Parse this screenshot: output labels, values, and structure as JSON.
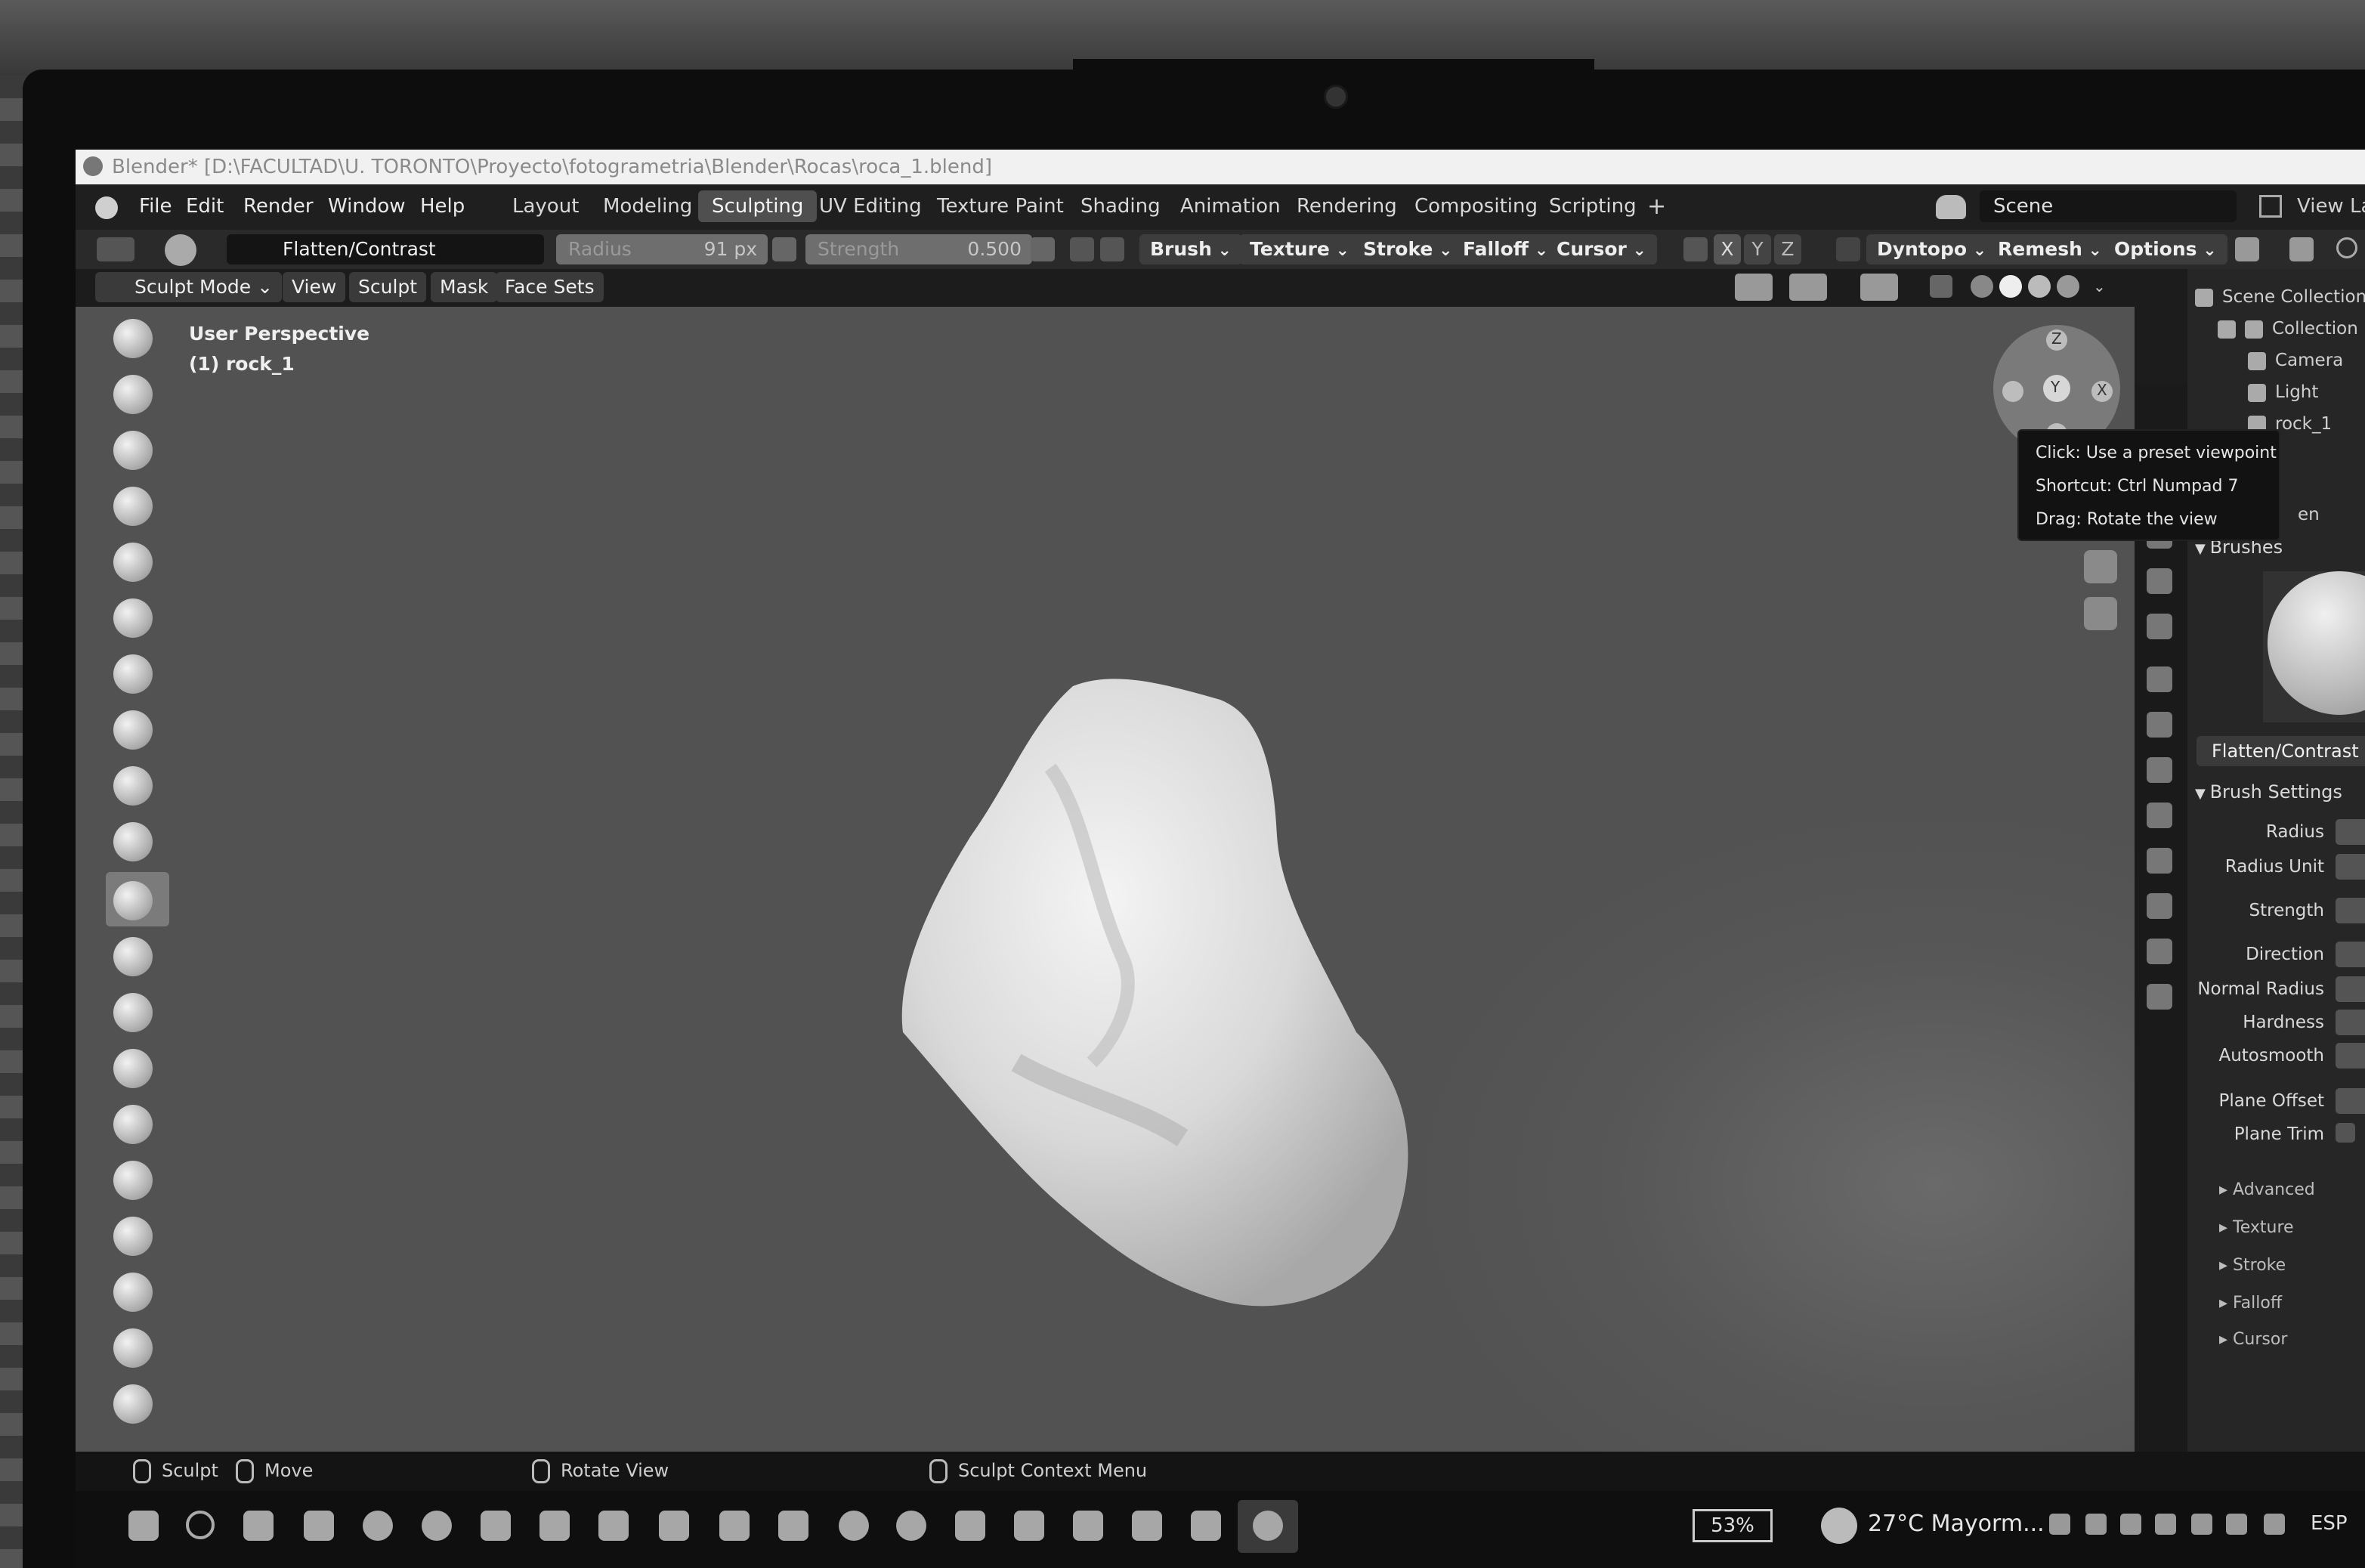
{
  "window": {
    "title": "Blender* [D:\\FACULTAD\\U. TORONTO\\Proyecto\\fotogrametria\\Blender\\Rocas\\roca_1.blend]"
  },
  "menu": {
    "items": [
      "File",
      "Edit",
      "Render",
      "Window",
      "Help"
    ]
  },
  "workspaces": {
    "tabs": [
      "Layout",
      "Modeling",
      "Sculpting",
      "UV Editing",
      "Texture Paint",
      "Shading",
      "Animation",
      "Rendering",
      "Compositing",
      "Scripting"
    ],
    "active": "Sculpting",
    "add_label": "+"
  },
  "scene": {
    "name": "Scene",
    "view_layer": "View Lay"
  },
  "tool_settings": {
    "brush_name": "Flatten/Contrast",
    "radius_label": "Radius",
    "radius_value": "91 px",
    "strength_label": "Strength",
    "strength_value": "0.500",
    "dropdowns": [
      "Brush",
      "Texture",
      "Stroke",
      "Falloff",
      "Cursor"
    ],
    "axis_labels": [
      "X",
      "Y",
      "Z"
    ],
    "right_dropdowns": [
      "Dyntopo",
      "Remesh",
      "Options"
    ]
  },
  "header": {
    "mode": "Sculpt Mode",
    "menus": [
      "View",
      "Sculpt",
      "Mask",
      "Face Sets"
    ]
  },
  "viewport": {
    "perspective": "User Perspective",
    "object_info": "(1) rock_1"
  },
  "gizmo": {
    "z": "Z",
    "y": "Y",
    "x": "X"
  },
  "tooltip": {
    "line1": "Click: Use a preset viewpoint",
    "line2": "Shortcut: Ctrl Numpad 7",
    "line3": "Drag: Rotate the view"
  },
  "outliner": {
    "root": "Scene Collection",
    "collection": "Collection",
    "items": [
      "Camera",
      "Light",
      "rock_1"
    ],
    "partial": "en"
  },
  "properties": {
    "brushes_header": "Brushes",
    "brush_name": "Flatten/Contrast",
    "brush_settings_header": "Brush Settings",
    "labels": [
      "Radius",
      "Radius Unit",
      "Strength",
      "Direction",
      "Normal Radius",
      "Hardness",
      "Autosmooth",
      "Plane Offset",
      "Plane Trim"
    ],
    "subsections": [
      "Advanced",
      "Texture",
      "Stroke",
      "Falloff",
      "Cursor"
    ]
  },
  "statusbar": {
    "sculpt": "Sculpt",
    "move": "Move",
    "rotate": "Rotate View",
    "context": "Sculpt Context Menu"
  },
  "taskbar": {
    "battery": "53%",
    "weather": "27°C  Mayorm...",
    "language": "ESP"
  }
}
